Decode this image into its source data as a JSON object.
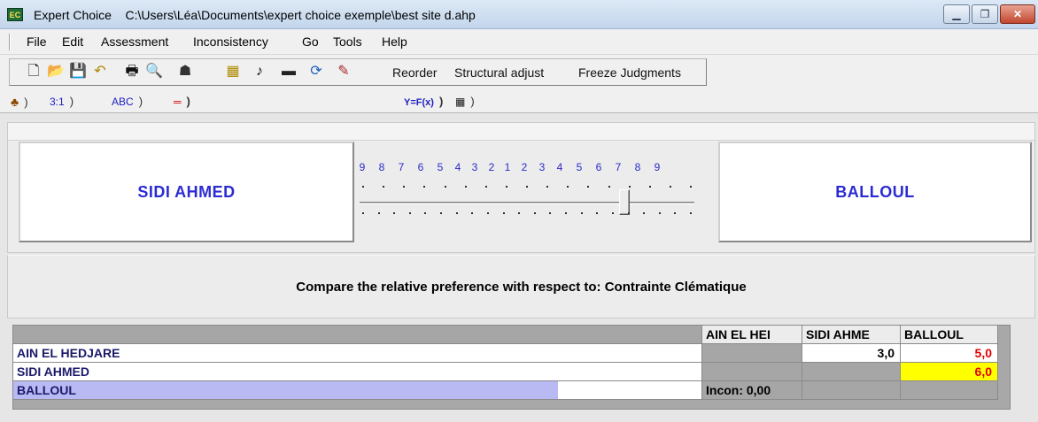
{
  "window": {
    "app_icon_text": "EC",
    "title_app": "Expert Choice",
    "title_path": "C:\\Users\\Léa\\Documents\\expert choice exemple\\best site d.ahp",
    "controls": {
      "minimize": "▁",
      "maximize": "❐",
      "close": "✕"
    }
  },
  "menu": {
    "items": [
      "File",
      "Edit",
      "Assessment",
      "Inconsistency",
      "Go",
      "Tools",
      "Help"
    ]
  },
  "toolbar": {
    "icons": [
      "new-file-icon",
      "open-folder-icon",
      "save-icon",
      "undo-icon",
      "print-icon",
      "print-preview-icon",
      "hierarchy-icon",
      "calculator-icon",
      "note-icon",
      "display-icon",
      "refresh-icon",
      "magic-wand-icon"
    ],
    "glyphs": [
      "🗋",
      "📂",
      "💾",
      "↶",
      "🖶",
      "🔍",
      "☗",
      "▦",
      "♪",
      "▬",
      "⟳",
      "✎"
    ],
    "reorder": "Reorder",
    "structural_adjust": "Structural adjust",
    "freeze": "Freeze Judgments"
  },
  "tabs": {
    "first_icon": "pairwise-icon",
    "numerical": "3:1",
    "verbal": "ABC",
    "graphical": "═",
    "formula": "Y=F(x)",
    "matrix": "▦"
  },
  "comparison": {
    "left": "SIDI AHMED",
    "right": "BALLOUL",
    "scale": [
      "9",
      "8",
      "7",
      "6",
      "5",
      "4",
      "3",
      "2",
      "1",
      "2",
      "3",
      "4",
      "5",
      "6",
      "7",
      "8",
      "9"
    ],
    "slider_value": 6,
    "slider_side": "right",
    "prompt": "Compare the relative preference  with respect to: Contrainte Clématique"
  },
  "matrix": {
    "columns": [
      "AIN EL HEI",
      "SIDI AHME",
      "BALLOUL"
    ],
    "rows": [
      {
        "label": "AIN EL HEDJARE",
        "values": [
          "",
          "3,0",
          "5,0"
        ]
      },
      {
        "label": "SIDI AHMED",
        "values": [
          "",
          "",
          "6,0"
        ]
      },
      {
        "label": "BALLOUL",
        "values": [
          "Incon: 0,00",
          "",
          ""
        ]
      }
    ],
    "highlight_color": "#ffff00",
    "inverse_color": "#e00000"
  }
}
